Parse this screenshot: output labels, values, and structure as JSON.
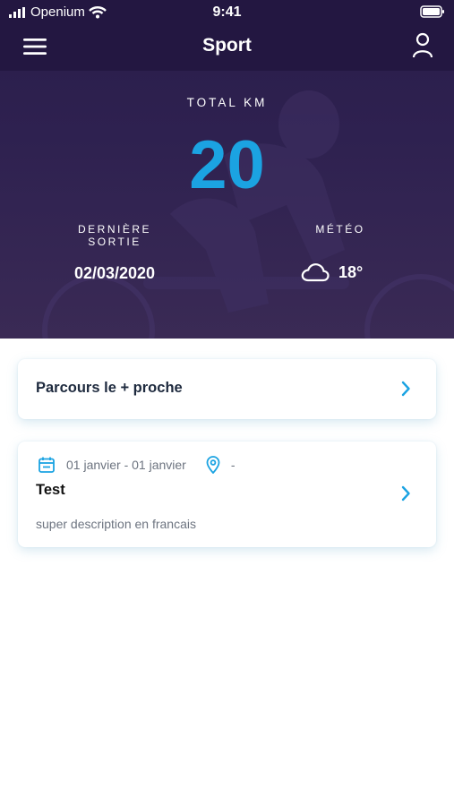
{
  "status": {
    "carrier": "Openium",
    "time": "9:41"
  },
  "nav": {
    "title": "Sport"
  },
  "stats": {
    "total_label": "TOTAL KM",
    "total_value": "20",
    "last_label_line1": "DERNIÈRE",
    "last_label_line2": "SORTIE",
    "last_value": "02/03/2020",
    "meteo_label": "MÉTÉO",
    "meteo_value": "18°",
    "meteo_icon": "cloud-icon"
  },
  "nearest": {
    "label": "Parcours le + proche"
  },
  "event": {
    "dates": "01 janvier - 01 janvier",
    "place": "-",
    "title": "Test",
    "description": "super description en francais"
  },
  "colors": {
    "accent": "#1ba3e2",
    "header": "#231741",
    "hero": "#2e2150"
  }
}
